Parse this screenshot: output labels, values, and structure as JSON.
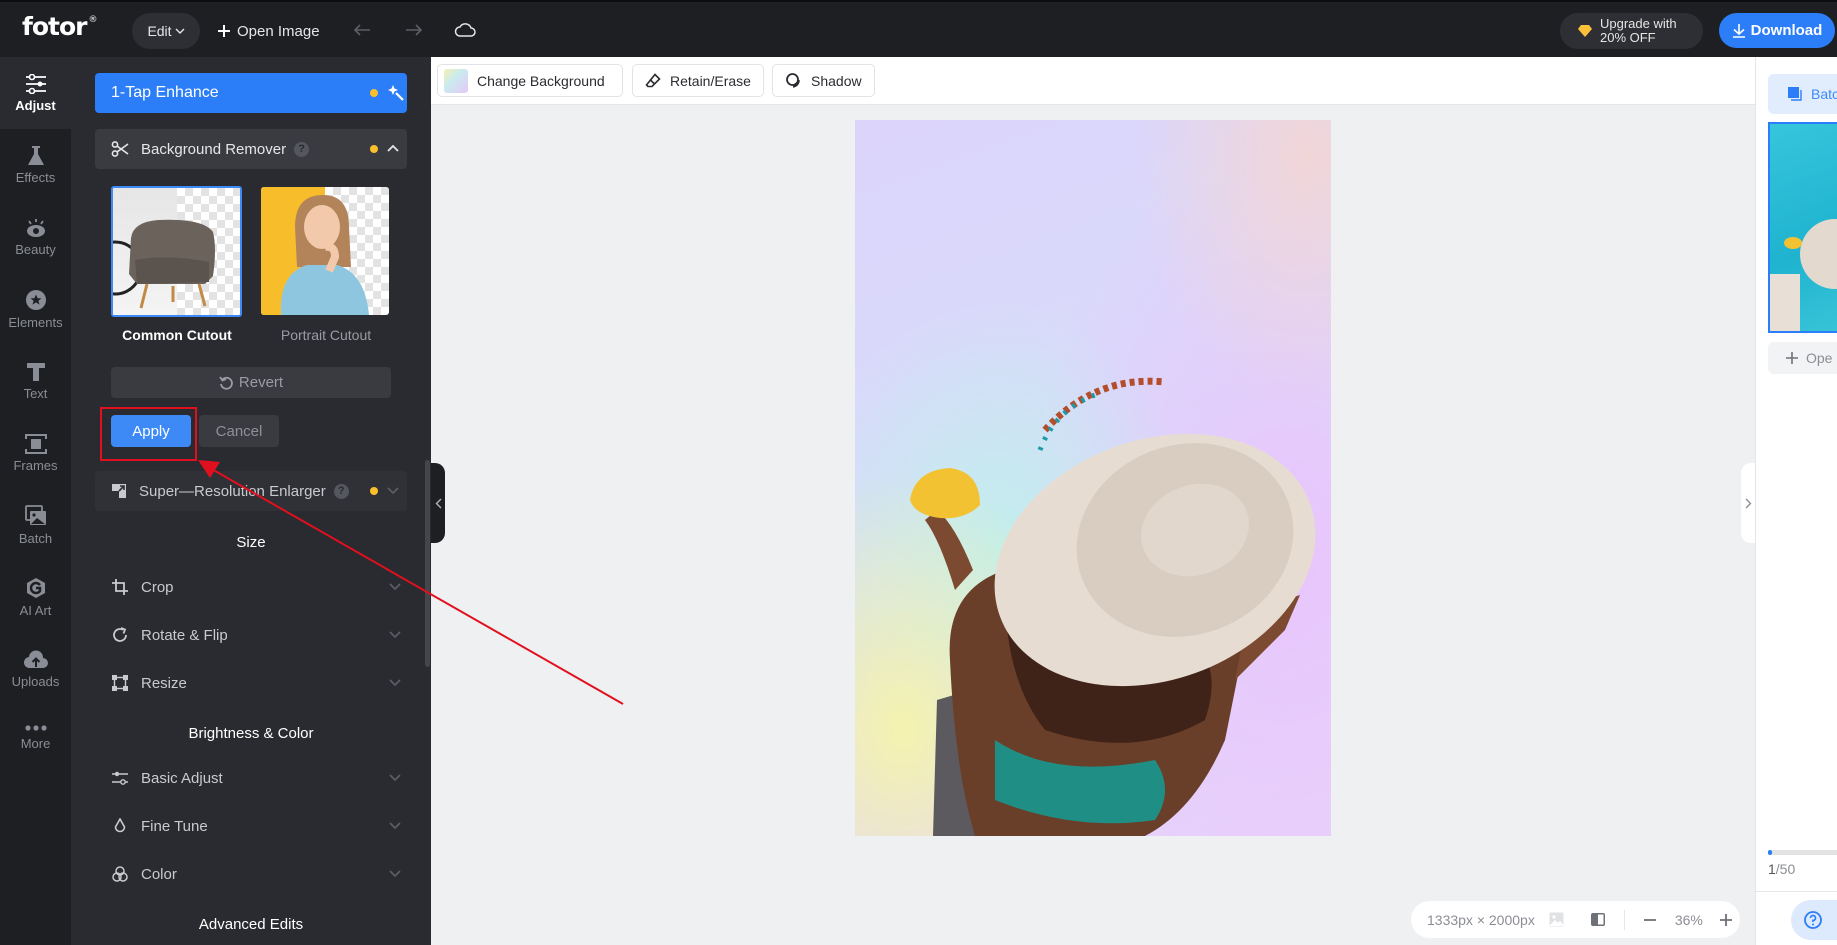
{
  "header": {
    "logo": "fotor",
    "logo_mark": "®",
    "edit_label": "Edit",
    "open_image_label": "Open Image",
    "upgrade_line1": "Upgrade with",
    "upgrade_line2": "20% OFF",
    "download_label": "Download"
  },
  "rail": {
    "items": [
      {
        "label": "Adjust",
        "icon": "sliders-icon",
        "active": true
      },
      {
        "label": "Effects",
        "icon": "flask-icon"
      },
      {
        "label": "Beauty",
        "icon": "eye-icon"
      },
      {
        "label": "Elements",
        "icon": "star-circle-icon"
      },
      {
        "label": "Text",
        "icon": "text-t-icon"
      },
      {
        "label": "Frames",
        "icon": "frame-icon"
      },
      {
        "label": "Batch",
        "icon": "images-icon"
      },
      {
        "label": "AI Art",
        "icon": "ai-art-icon"
      },
      {
        "label": "Uploads",
        "icon": "cloud-upload-icon"
      },
      {
        "label": "More",
        "icon": "more-dots-icon"
      }
    ]
  },
  "panel": {
    "enhance_label": "1-Tap Enhance",
    "bg_remover_label": "Background Remover",
    "cutouts": [
      {
        "label": "Common Cutout",
        "selected": true
      },
      {
        "label": "Portrait Cutout",
        "selected": false
      }
    ],
    "revert_label": "Revert",
    "apply_label": "Apply",
    "cancel_label": "Cancel",
    "super_res_label": "Super—Resolution Enlarger",
    "sections": {
      "size": "Size",
      "brightness": "Brightness & Color",
      "advanced": "Advanced Edits"
    },
    "size_items": [
      "Crop",
      "Rotate & Flip",
      "Resize"
    ],
    "brightness_items": [
      "Basic Adjust",
      "Fine Tune",
      "Color"
    ]
  },
  "toolbar": {
    "change_bg": "Change Background",
    "retain_erase": "Retain/Erase",
    "shadow": "Shadow"
  },
  "bottombar": {
    "dimensions": "1333px × 2000px",
    "zoom": "36%"
  },
  "rightpanel": {
    "batch_label": "Batc",
    "open_label": "Ope",
    "page_current": "1",
    "page_total": "/50",
    "progress_fraction": 0.02
  },
  "colors": {
    "accent": "#2c7ef8",
    "badge_dot": "#fbbf2c",
    "annotation": "#e0101e"
  }
}
